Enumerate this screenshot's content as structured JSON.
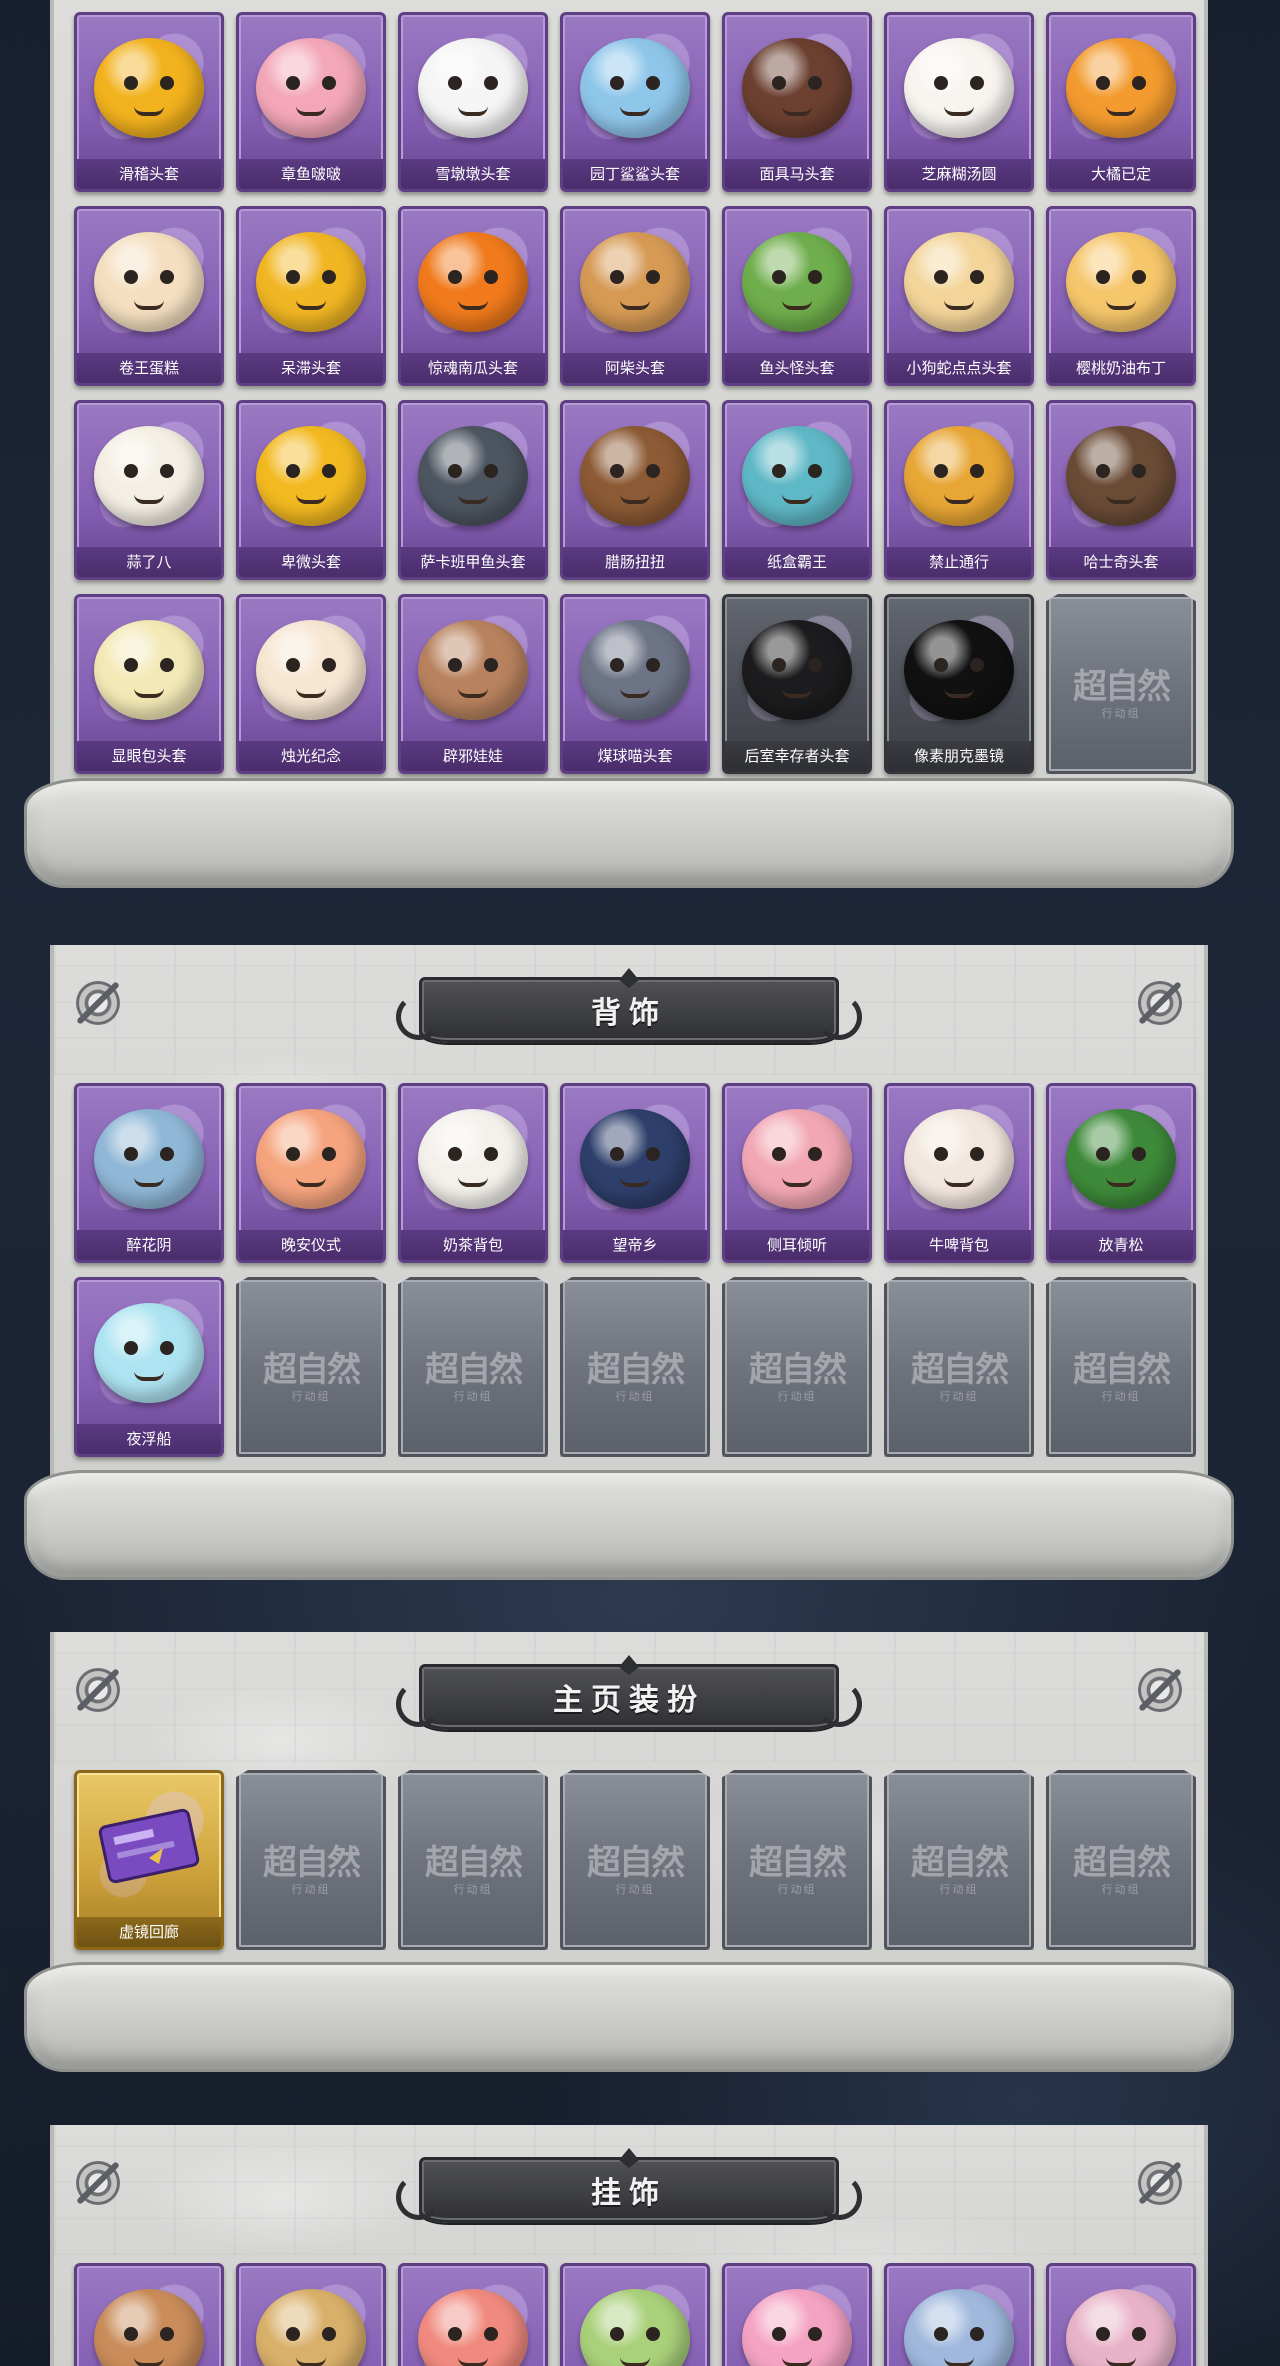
{
  "sections": {
    "heads": {
      "items": [
        {
          "label": "滑稽头套",
          "tone": "purple",
          "icon": "smirk-face-head-icon",
          "color": "#f2b21e"
        },
        {
          "label": "章鱼啵啵",
          "tone": "purple",
          "icon": "pink-octopus-icon",
          "color": "#f3a7b9"
        },
        {
          "label": "雪墩墩头套",
          "tone": "purple",
          "icon": "snowman-head-icon",
          "color": "#f5f5f5"
        },
        {
          "label": "园丁鲨鲨头套",
          "tone": "purple",
          "icon": "shark-head-icon",
          "color": "#8ec6ea"
        },
        {
          "label": "面具马头套",
          "tone": "purple",
          "icon": "horse-head-icon",
          "color": "#6b4030"
        },
        {
          "label": "芝麻糊汤圆",
          "tone": "purple",
          "icon": "dumpling-head-icon",
          "color": "#f8f4f0"
        },
        {
          "label": "大橘已定",
          "tone": "purple",
          "icon": "orange-slice-head-icon",
          "color": "#f39b2f"
        },
        {
          "label": "卷王蛋糕",
          "tone": "purple",
          "icon": "roll-cake-head-icon",
          "color": "#f5dfc0"
        },
        {
          "label": "呆滞头套",
          "tone": "purple",
          "icon": "blank-stare-face-icon",
          "color": "#f1b623"
        },
        {
          "label": "惊魂南瓜头套",
          "tone": "purple",
          "icon": "pumpkin-head-icon",
          "color": "#f07a1c"
        },
        {
          "label": "阿柴头套",
          "tone": "purple",
          "icon": "shiba-dog-head-icon",
          "color": "#d69a55"
        },
        {
          "label": "鱼头怪头套",
          "tone": "purple",
          "icon": "fish-head-icon",
          "color": "#6fae4c"
        },
        {
          "label": "小狗蛇点点头套",
          "tone": "purple",
          "icon": "puppy-snake-head-icon",
          "color": "#f3d59a"
        },
        {
          "label": "樱桃奶油布丁",
          "tone": "purple",
          "icon": "pudding-head-icon",
          "color": "#f6c66a"
        },
        {
          "label": "蒜了八",
          "tone": "purple",
          "icon": "garlic-head-icon",
          "color": "#f4efe4"
        },
        {
          "label": "卑微头套",
          "tone": "purple",
          "icon": "sad-face-head-icon",
          "color": "#f2b920"
        },
        {
          "label": "萨卡班甲鱼头套",
          "tone": "purple",
          "icon": "sacabambaspis-head-icon",
          "color": "#4d5560"
        },
        {
          "label": "腊肠扭扭",
          "tone": "purple",
          "icon": "dachshund-head-icon",
          "color": "#8c5a34"
        },
        {
          "label": "纸盒霸王",
          "tone": "purple",
          "icon": "cardboard-dinosaur-icon",
          "color": "#5fb8c6"
        },
        {
          "label": "禁止通行",
          "tone": "purple",
          "icon": "traffic-cone-icon",
          "color": "#e8a635"
        },
        {
          "label": "哈士奇头套",
          "tone": "purple",
          "icon": "husky-sunglasses-head-icon",
          "color": "#6a4b36"
        },
        {
          "label": "显眼包头套",
          "tone": "purple",
          "icon": "lightbulb-head-icon",
          "color": "#f3e9b6"
        },
        {
          "label": "烛光纪念",
          "tone": "purple",
          "icon": "candle-head-icon",
          "color": "#f7e6d2"
        },
        {
          "label": "辟邪娃娃",
          "tone": "purple",
          "icon": "doll-head-icon",
          "color": "#b8825e"
        },
        {
          "label": "煤球喵头套",
          "tone": "purple",
          "icon": "gray-cat-head-icon",
          "color": "#6d7486"
        },
        {
          "label": "后室幸存者头套",
          "tone": "dark",
          "icon": "gas-mask-helmet-icon",
          "color": "#1c1c1e"
        },
        {
          "label": "像素朋克墨镜",
          "tone": "dark",
          "icon": "pixel-sunglasses-icon",
          "color": "#111111"
        }
      ],
      "empty_count": 1
    },
    "back": {
      "title": "背饰",
      "items": [
        {
          "label": "醉花阴",
          "tone": "purple",
          "icon": "floral-wings-icon",
          "color": "#8fb7d6"
        },
        {
          "label": "晚安仪式",
          "tone": "purple",
          "icon": "pink-pig-doll-icon",
          "color": "#f5a47e"
        },
        {
          "label": "奶茶背包",
          "tone": "purple",
          "icon": "milk-tea-bag-icon",
          "color": "#f4f1ec"
        },
        {
          "label": "望帝乡",
          "tone": "purple",
          "icon": "opera-doll-icon",
          "color": "#2e3f6b"
        },
        {
          "label": "侧耳倾听",
          "tone": "purple",
          "icon": "lotus-ring-icon",
          "color": "#f2a7b4"
        },
        {
          "label": "牛啤背包",
          "tone": "purple",
          "icon": "cow-beer-barrel-icon",
          "color": "#f2e7df"
        },
        {
          "label": "放青松",
          "tone": "purple",
          "icon": "pine-bonsai-icon",
          "color": "#3e8a3a"
        },
        {
          "label": "夜浮船",
          "tone": "purple",
          "icon": "jellyfish-ship-icon",
          "color": "#aee4f2"
        }
      ],
      "empty_count": 6
    },
    "home": {
      "title": "主页装扮",
      "items": [
        {
          "label": "虚镜回廊",
          "tone": "gold",
          "icon": "purple-ticket-icon",
          "color": "#7a4bc0"
        }
      ],
      "empty_count": 6
    },
    "charms": {
      "title": "挂饰",
      "items": [
        {
          "tone": "purple",
          "icon": "bear-charm-icon",
          "color": "#c98c5a"
        },
        {
          "tone": "purple",
          "icon": "elf-charm-icon",
          "color": "#d9b06a"
        },
        {
          "tone": "purple",
          "icon": "fox-girl-charm-icon",
          "color": "#f08a7e"
        },
        {
          "tone": "purple",
          "icon": "green-pouch-charm-icon",
          "color": "#a9d07a"
        },
        {
          "tone": "purple",
          "icon": "pink-cat-charm-icon",
          "color": "#f4a3c2"
        },
        {
          "tone": "purple",
          "icon": "chibi-charm-icon",
          "color": "#9fb8dc"
        },
        {
          "tone": "purple",
          "icon": "ribbon-charm-icon",
          "color": "#e8b3c8"
        }
      ]
    }
  },
  "empty_slot": {
    "watermark": "超自然",
    "watermark_sub": "行动组"
  }
}
